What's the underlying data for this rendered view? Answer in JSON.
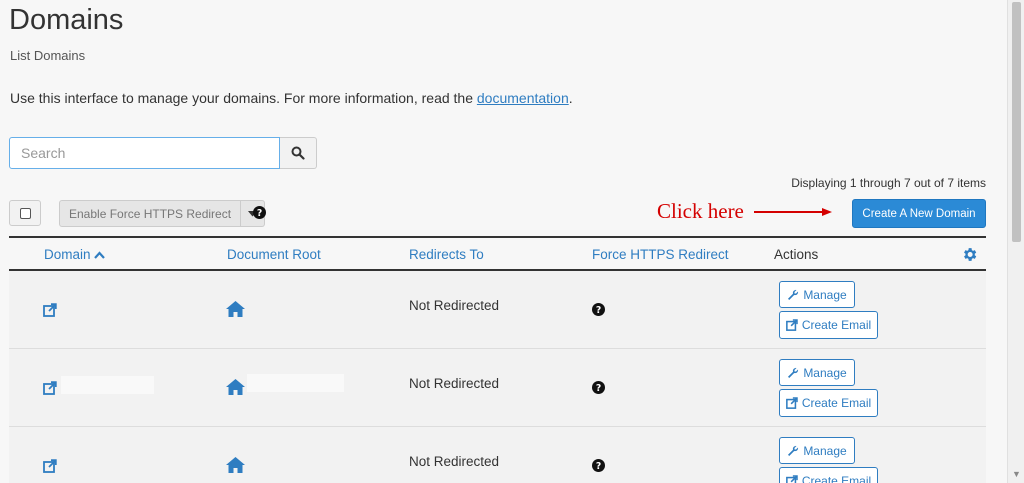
{
  "page": {
    "title": "Domains",
    "subtitle": "List Domains",
    "intro_text": "Use this interface to manage your domains. For more information, read the ",
    "intro_link": "documentation",
    "intro_end": "."
  },
  "search": {
    "placeholder": "Search"
  },
  "pagination": {
    "display_text": "Displaying 1 through 7 out of 7 items"
  },
  "toolbar": {
    "force_https_label": "Enable Force HTTPS Redirect",
    "create_domain_label": "Create A New Domain"
  },
  "annotation": {
    "text": "Click here",
    "color": "#d40000"
  },
  "table": {
    "headers": {
      "domain": "Domain",
      "document_root": "Document Root",
      "redirects_to": "Redirects To",
      "force_https": "Force HTTPS Redirect",
      "actions": "Actions"
    },
    "rows": [
      {
        "redirects_to": "Not Redirected",
        "manage_label": "Manage",
        "email_label": "Create Email"
      },
      {
        "redirects_to": "Not Redirected",
        "manage_label": "Manage",
        "email_label": "Create Email"
      },
      {
        "redirects_to": "Not Redirected",
        "manage_label": "Manage",
        "email_label": "Create Email"
      }
    ]
  },
  "colors": {
    "link": "#2f7dc1",
    "primary_button": "#2b8ad6",
    "background": "#f7f7f7"
  },
  "icons": [
    "search-icon",
    "question-circle-icon",
    "caret-down-icon",
    "gear-icon",
    "external-link-icon",
    "home-icon",
    "wrench-icon",
    "edit-icon",
    "sort-up-icon"
  ]
}
